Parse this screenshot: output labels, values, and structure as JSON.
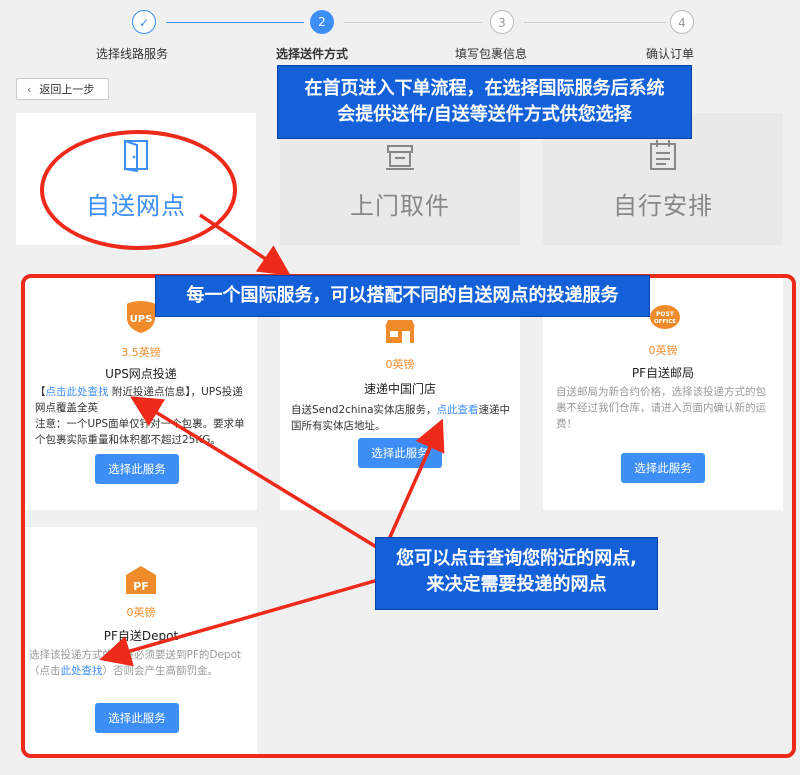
{
  "steps": [
    {
      "num": "✓",
      "label": "选择线路服务",
      "state": "done"
    },
    {
      "num": "2",
      "label": "选择送件方式",
      "state": "active"
    },
    {
      "num": "3",
      "label": "填写包裹信息",
      "state": "todo"
    },
    {
      "num": "4",
      "label": "确认订单",
      "state": "todo"
    }
  ],
  "back_button": {
    "label": "返回上一步",
    "icon": "chevron-left-icon"
  },
  "modes": [
    {
      "label": "自送网点",
      "icon": "door-icon",
      "state": "active"
    },
    {
      "label": "上门取件",
      "icon": "pickup-box-icon",
      "state": "inactive"
    },
    {
      "label": "自行安排",
      "icon": "calendar-icon",
      "state": "inactive"
    }
  ],
  "services": {
    "ups": {
      "logo": "UPS",
      "price": "3.5英镑",
      "title": "UPS网点投递",
      "desc_prefix": "【",
      "desc_link": "点击此处查找",
      "desc_middle": " 附近投递点信息】，UPS投递网点覆盖全英",
      "desc_note": "注意：一个UPS面单仅针对一个包裹。要求单个包裹实际重量和体积都不超过25KG。",
      "button": "选择此服务"
    },
    "sutong": {
      "logo": "store-icon",
      "price": "0英镑",
      "title": "速递中国门店",
      "desc_prefix": "自送Send2china实体店服务，",
      "desc_link": "点此查看",
      "desc_suffix": "速递中国所有实体店地址。",
      "button": "选择此服务"
    },
    "pf_post": {
      "logo_line1": "POST",
      "logo_line2": "OFFICE",
      "price": "0英镑",
      "title": "PF自送邮局",
      "desc": "自送邮局为新合约价格，选择该投递方式的包裹不经过我们仓库，请进入页面内确认新的运费！",
      "button": "选择此服务"
    },
    "pf_depot": {
      "logo": "PF",
      "price": "0英镑",
      "title": "PF自送Depot",
      "desc_line1": "选择该投递方式的包裹必须要送到PF的Depot",
      "desc_prefix": "（点击",
      "desc_link": "此处查找",
      "desc_suffix": "）否则会产生高额罚金。",
      "button": "选择此服务"
    }
  },
  "annotations": {
    "top_callout": [
      "在首页进入下单流程，在选择国际服务后系统",
      "会提供送件/自送等送件方式供您选择"
    ],
    "middle_callout": "每一个国际服务，可以搭配不同的自送网点的投递服务",
    "bottom_callout": [
      "您可以点击查询您附近的网点,",
      "来决定需要投递的网点"
    ]
  },
  "colors": {
    "accent": "#3e8ef7",
    "price": "#f08b2c",
    "annotation_red": "#ee2a1a",
    "callout_blue": "#1460d8"
  }
}
